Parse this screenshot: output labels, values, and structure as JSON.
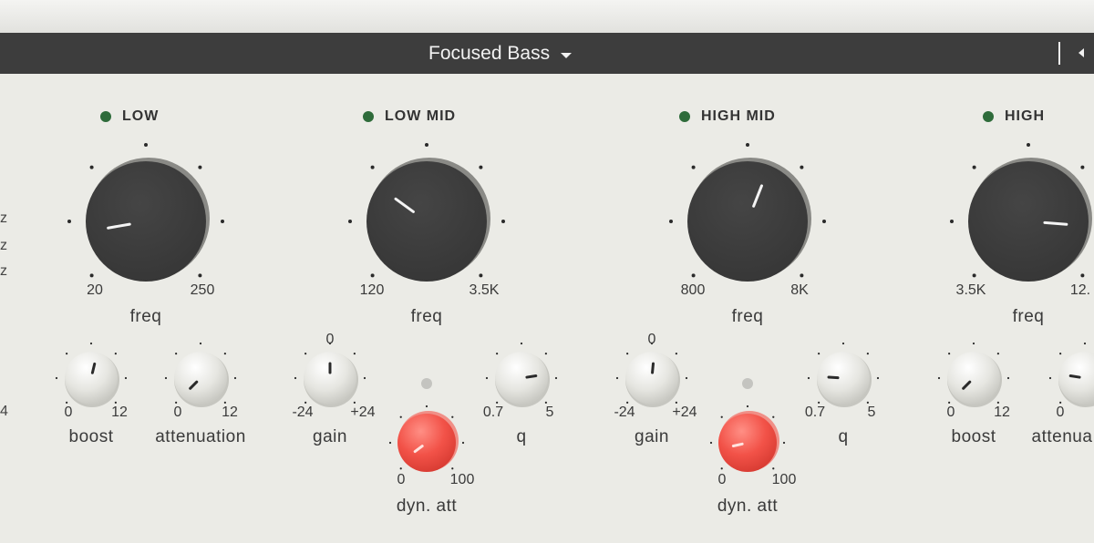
{
  "preset": {
    "name": "Focused Bass"
  },
  "left_edge": {
    "unit_labels": [
      "z",
      "z",
      "z"
    ],
    "value_label": "4"
  },
  "bands": [
    {
      "id": "low",
      "title": "LOW",
      "led_color": "#2e6b3a",
      "freq": {
        "name": "freq",
        "min": "20",
        "max": "250",
        "value": 0.13
      },
      "left": {
        "name": "boost",
        "min": "0",
        "max": "12",
        "value": 0.55
      },
      "right": {
        "name": "attenuation",
        "min": "0",
        "max": "12",
        "value": 0.0
      }
    },
    {
      "id": "low-mid",
      "title": "LOW MID",
      "led_color": "#2e6b3a",
      "freq": {
        "name": "freq",
        "min": "120",
        "max": "3.5K",
        "value": 0.3
      },
      "gain": {
        "name": "gain",
        "min": "-24",
        "max": "+24",
        "center": "0",
        "value": 0.5
      },
      "q": {
        "name": "q",
        "min": "0.7",
        "max": "5",
        "value": 0.8
      },
      "dyn": {
        "name": "dyn. att",
        "min": "0",
        "max": "100",
        "value": 0.03
      }
    },
    {
      "id": "high-mid",
      "title": "HIGH MID",
      "led_color": "#2e6b3a",
      "freq": {
        "name": "freq",
        "min": "800",
        "max": "8K",
        "value": 0.58
      },
      "gain": {
        "name": "gain",
        "min": "-24",
        "max": "+24",
        "center": "0",
        "value": 0.52
      },
      "q": {
        "name": "q",
        "min": "0.7",
        "max": "5",
        "value": 0.18
      },
      "dyn": {
        "name": "dyn. att",
        "min": "0",
        "max": "100",
        "value": 0.12
      }
    },
    {
      "id": "high",
      "title": "HIGH",
      "led_color": "#2e6b3a",
      "freq": {
        "name": "freq",
        "min": "3.5K",
        "max": "12.",
        "value": 0.85
      },
      "left": {
        "name": "boost",
        "min": "0",
        "max": "12",
        "value": 0.0
      },
      "right": {
        "name": "attenua",
        "min": "0",
        "max": "",
        "value": 0.2
      }
    }
  ]
}
